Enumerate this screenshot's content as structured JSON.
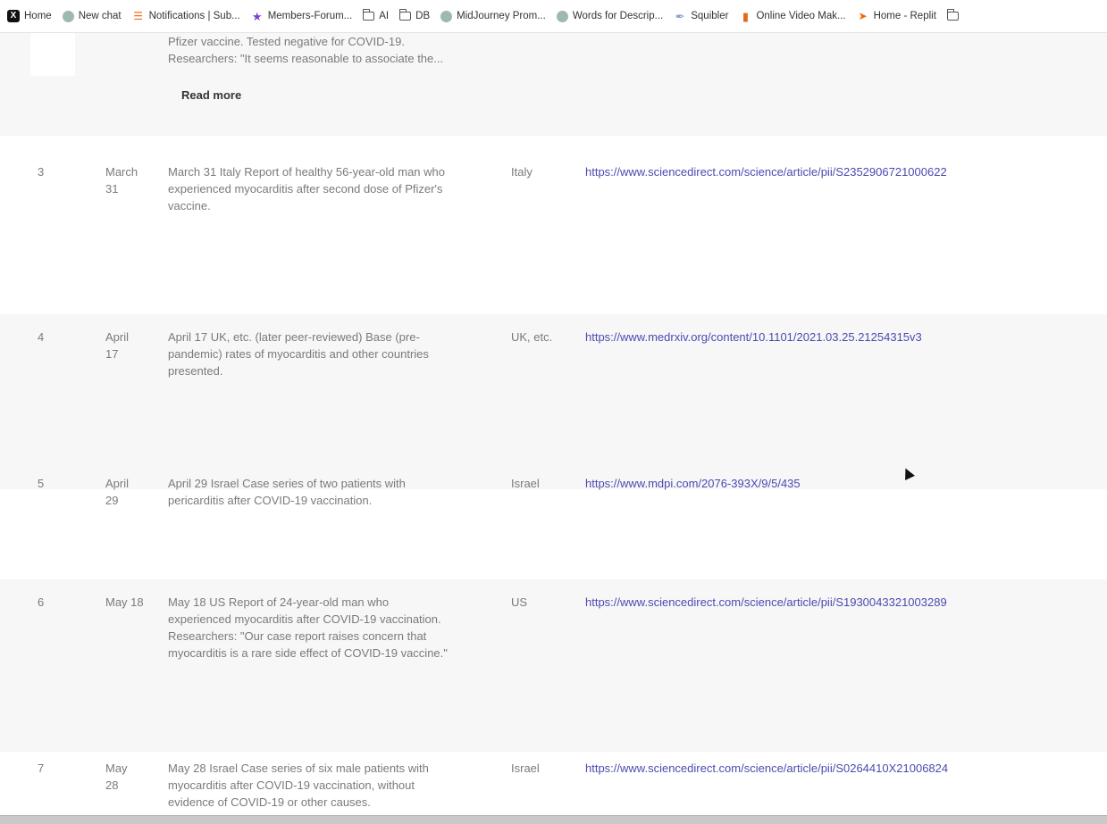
{
  "bookmarks": [
    {
      "icon": "x-icon",
      "label": "Home"
    },
    {
      "icon": "chatgpt-icon",
      "label": "New chat"
    },
    {
      "icon": "substack-icon",
      "label": "Notifications | Sub..."
    },
    {
      "icon": "star-icon",
      "label": "Members-Forum..."
    },
    {
      "icon": "folder-icon",
      "label": "AI"
    },
    {
      "icon": "folder-icon",
      "label": "DB"
    },
    {
      "icon": "chatgpt-icon",
      "label": "MidJourney Prom..."
    },
    {
      "icon": "chatgpt-icon",
      "label": "Words for Descrip..."
    },
    {
      "icon": "feather-icon",
      "label": "Squibler"
    },
    {
      "icon": "bolt-icon",
      "label": "Online Video Mak..."
    },
    {
      "icon": "replit-icon",
      "label": "Home - Replit"
    }
  ],
  "partial_row": {
    "desc_lines": [
      "Pfizer vaccine. Tested negative for COVID-19.",
      "Researchers: \"It seems reasonable to associate the..."
    ],
    "read_more": "Read more"
  },
  "rows": [
    {
      "num": "3",
      "date_lines": [
        "March",
        "31"
      ],
      "desc_lines": [
        "March 31 Italy Report of healthy 56-year-old man who",
        "experienced myocarditis after second dose of Pfizer's",
        "vaccine."
      ],
      "country": "Italy",
      "link": "https://www.sciencedirect.com/science/article/pii/S2352906721000622"
    },
    {
      "num": "4",
      "date_lines": [
        "April",
        "17"
      ],
      "desc_lines": [
        "April 17 UK, etc. (later peer-reviewed) Base (pre-",
        "pandemic) rates of myocarditis and other countries",
        "presented."
      ],
      "country": "UK, etc.",
      "link": "https://www.medrxiv.org/content/10.1101/2021.03.25.21254315v3"
    },
    {
      "num": "5",
      "date_lines": [
        "April",
        "29"
      ],
      "desc_lines": [
        "April 29 Israel Case series of two patients with",
        "pericarditis after COVID-19 vaccination."
      ],
      "country": "Israel",
      "link": "https://www.mdpi.com/2076-393X/9/5/435"
    },
    {
      "num": "6",
      "date_lines": [
        "May 18"
      ],
      "desc_lines": [
        "May 18 US Report of 24-year-old man who",
        "experienced myocarditis after COVID-19 vaccination.",
        "Researchers: \"Our case report raises concern that",
        "myocarditis is a rare side effect of COVID-19 vaccine.\""
      ],
      "country": "US",
      "link": "https://www.sciencedirect.com/science/article/pii/S1930043321003289"
    },
    {
      "num": "7",
      "date_lines": [
        "May",
        "28"
      ],
      "desc_lines": [
        "May 28 Israel Case series of six male patients with",
        "myocarditis after COVID-19 vaccination, without",
        "evidence of COVID-19 or other causes."
      ],
      "country": "Israel",
      "link": "https://www.sciencedirect.com/science/article/pii/S0264410X21006824"
    }
  ]
}
